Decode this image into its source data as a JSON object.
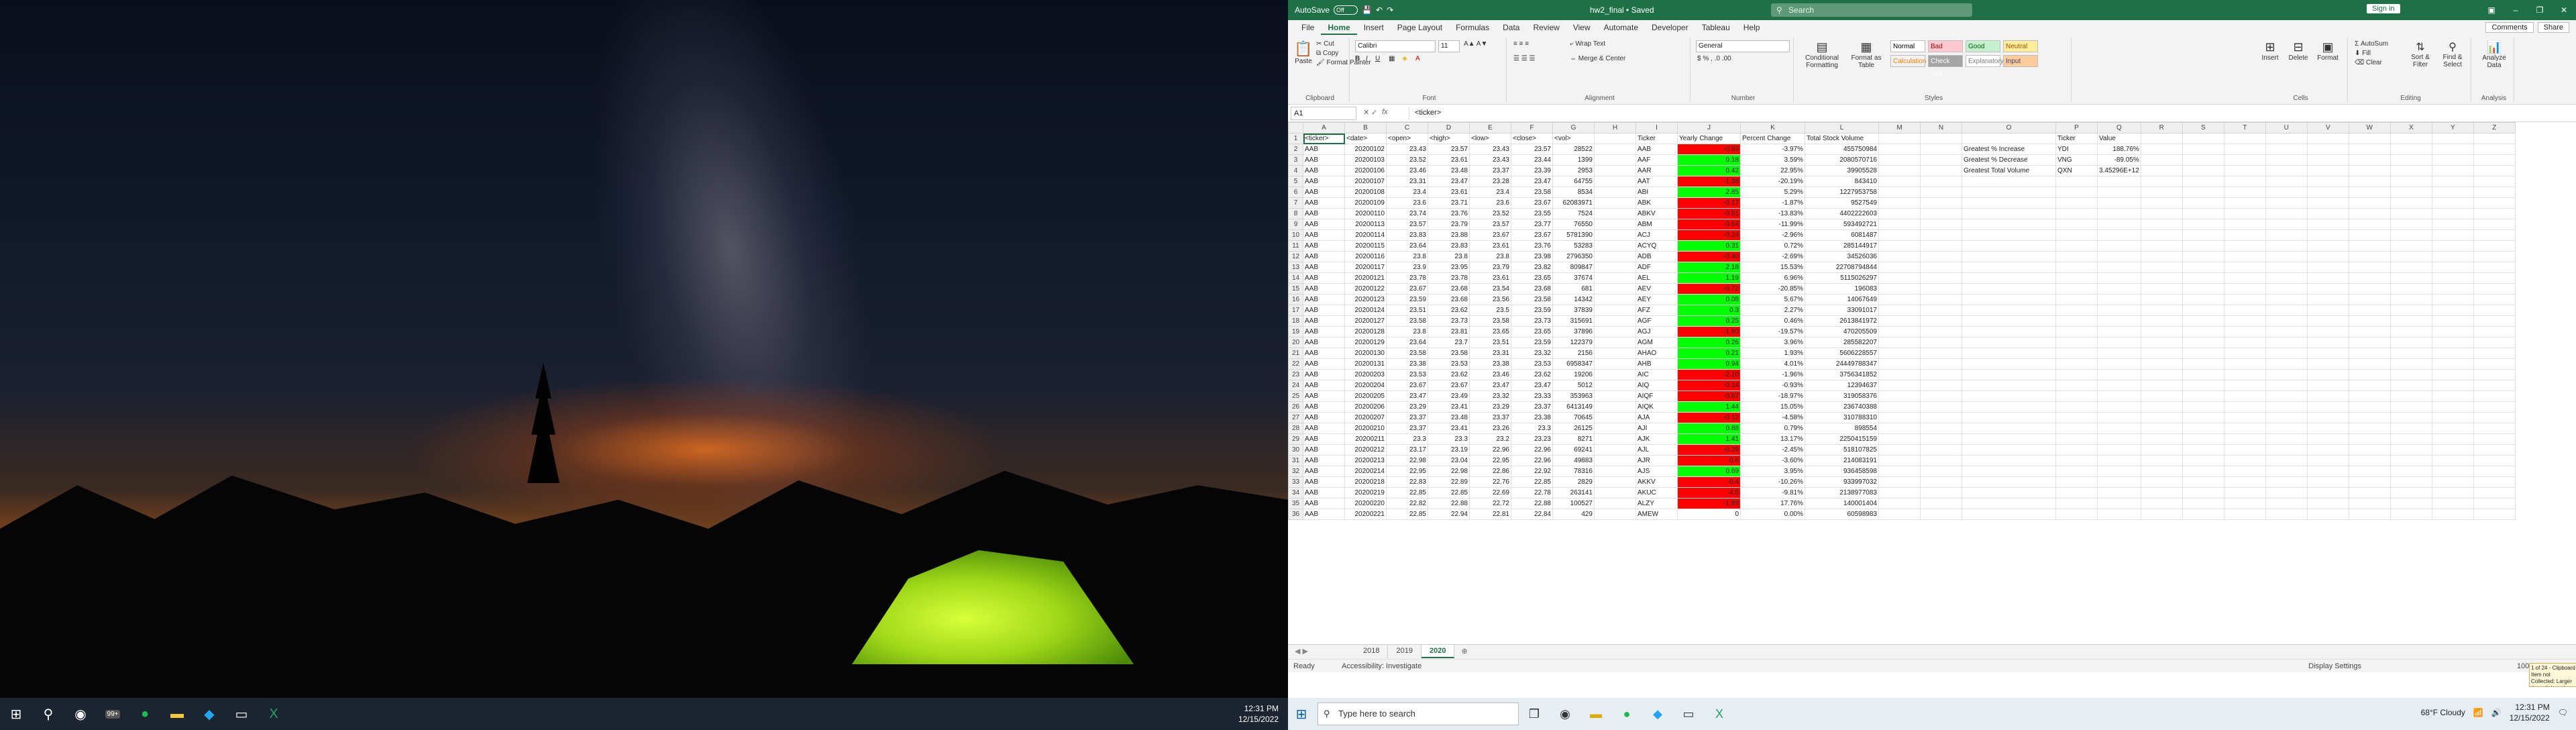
{
  "left_taskbar": {
    "icons": [
      "windows-icon",
      "search-icon",
      "chrome-icon",
      "weather-badge-icon",
      "spotify-icon",
      "explorer-icon",
      "vscode-icon",
      "terminal-icon",
      "excel-icon"
    ],
    "weather_badge": "99+",
    "time": "12:31 PM",
    "date": "12/15/2022"
  },
  "excel": {
    "title": {
      "autosave": "AutoSave",
      "toggle": "Off",
      "document": "hw2_final • Saved",
      "search": "Search",
      "signin": "Sign in"
    },
    "menu": {
      "items": [
        "File",
        "Home",
        "Insert",
        "Page Layout",
        "Formulas",
        "Data",
        "Review",
        "View",
        "Automate",
        "Developer",
        "Tableau",
        "Help"
      ],
      "active": "Home",
      "comments": "Comments",
      "share": "Share"
    },
    "ribbon": {
      "clipboard": {
        "paste": "Paste",
        "cut": "Cut",
        "copy": "Copy",
        "format_painter": "Format Painter",
        "label": "Clipboard"
      },
      "font": {
        "name": "Calibri",
        "size": "11",
        "label": "Font"
      },
      "alignment": {
        "wrap": "Wrap Text",
        "merge": "Merge & Center",
        "label": "Alignment"
      },
      "number": {
        "format": "General",
        "label": "Number"
      },
      "styles": {
        "conditional": "Conditional Formatting",
        "format_table": "Format as Table",
        "cells": [
          "Normal",
          "Bad",
          "Good",
          "Neutral",
          "Calculation",
          "Check Cell",
          "Explanatory...",
          "Input"
        ],
        "label": "Styles"
      },
      "cells": {
        "insert": "Insert",
        "delete": "Delete",
        "format": "Format",
        "label": "Cells"
      },
      "editing": {
        "autosum": "AutoSum",
        "fill": "Fill",
        "clear": "Clear",
        "sort": "Sort & Filter",
        "find": "Find & Select",
        "label": "Editing"
      },
      "analysis": {
        "analyze": "Analyze Data",
        "label": "Analysis"
      }
    },
    "formula_bar": {
      "name_box": "A1",
      "fx": "fx",
      "content": "<ticker>"
    },
    "columns": [
      "A",
      "B",
      "C",
      "D",
      "E",
      "F",
      "G",
      "H",
      "I",
      "J",
      "K",
      "L",
      "M",
      "N",
      "O",
      "P",
      "Q",
      "R",
      "S",
      "T",
      "U",
      "V",
      "W",
      "X",
      "Y",
      "Z"
    ],
    "headers": [
      "<ticker>",
      "<date>",
      "<open>",
      "<high>",
      "<low>",
      "<close>",
      "<vol>",
      "",
      "Ticker",
      "Yearly Change",
      "Percent Change",
      "Total Stock Volume"
    ],
    "rows": [
      [
        "AAB",
        "20200102",
        "23.43",
        "23.57",
        "23.43",
        "23.57",
        "28522",
        "",
        "AAB",
        "-0.93",
        "-3.97%",
        "455750984"
      ],
      [
        "AAB",
        "20200103",
        "23.52",
        "23.61",
        "23.43",
        "23.44",
        "1399",
        "",
        "AAF",
        "0.18",
        "3.59%",
        "2080570716"
      ],
      [
        "AAB",
        "20200106",
        "23.46",
        "23.48",
        "23.37",
        "23.39",
        "2953",
        "",
        "AAR",
        "0.42",
        "22.95%",
        "39905528"
      ],
      [
        "AAB",
        "20200107",
        "23.31",
        "23.47",
        "23.28",
        "23.47",
        "64755",
        "",
        "AAT",
        "-1.38",
        "-20.19%",
        "843410"
      ],
      [
        "AAB",
        "20200108",
        "23.4",
        "23.61",
        "23.4",
        "23.58",
        "8534",
        "",
        "ABI",
        "2.85",
        "5.29%",
        "1227953758"
      ],
      [
        "AAB",
        "20200109",
        "23.6",
        "23.71",
        "23.6",
        "23.67",
        "62083971",
        "",
        "ABK",
        "-0.17",
        "-1.87%",
        "9527549"
      ],
      [
        "AAB",
        "20200110",
        "23.74",
        "23.76",
        "23.52",
        "23.55",
        "7524",
        "",
        "ABKV",
        "-0.51",
        "-13.83%",
        "4402222603"
      ],
      [
        "AAB",
        "20200113",
        "23.57",
        "23.79",
        "23.57",
        "23.77",
        "76550",
        "",
        "ABM",
        "-0.64",
        "-11.99%",
        "593492721"
      ],
      [
        "AAB",
        "20200114",
        "23.83",
        "23.88",
        "23.67",
        "23.67",
        "5781390",
        "",
        "ACJ",
        "-0.24",
        "-2.96%",
        "6081487"
      ],
      [
        "AAB",
        "20200115",
        "23.64",
        "23.83",
        "23.61",
        "23.76",
        "53283",
        "",
        "ACYQ",
        "0.31",
        "0.72%",
        "285144917"
      ],
      [
        "AAB",
        "20200116",
        "23.8",
        "23.8",
        "23.8",
        "23.98",
        "2796350",
        "",
        "ADB",
        "-0.40",
        "-2.69%",
        "34526036"
      ],
      [
        "AAB",
        "20200117",
        "23.9",
        "23.95",
        "23.79",
        "23.82",
        "809847",
        "",
        "ADF",
        "2.18",
        "15.53%",
        "22708794844"
      ],
      [
        "AAB",
        "20200121",
        "23.78",
        "23.78",
        "23.61",
        "23.65",
        "37674",
        "",
        "AEL",
        "1.19",
        "6.96%",
        "5115026297"
      ],
      [
        "AAB",
        "20200122",
        "23.67",
        "23.68",
        "23.54",
        "23.68",
        "681",
        "",
        "AEV",
        "-0.72",
        "-20.85%",
        "196083"
      ],
      [
        "AAB",
        "20200123",
        "23.59",
        "23.68",
        "23.56",
        "23.58",
        "14342",
        "",
        "AEY",
        "0.08",
        "5.67%",
        "14067649"
      ],
      [
        "AAB",
        "20200124",
        "23.51",
        "23.62",
        "23.5",
        "23.59",
        "37839",
        "",
        "AFZ",
        "0.3",
        "2.27%",
        "33091017"
      ],
      [
        "AAB",
        "20200127",
        "23.58",
        "23.73",
        "23.58",
        "23.73",
        "315691",
        "",
        "AGF",
        "0.25",
        "0.46%",
        "2613841972"
      ],
      [
        "AAB",
        "20200128",
        "23.8",
        "23.81",
        "23.65",
        "23.65",
        "37896",
        "",
        "AGJ",
        "-1.60",
        "-19.57%",
        "470205509"
      ],
      [
        "AAB",
        "20200129",
        "23.64",
        "23.7",
        "23.51",
        "23.59",
        "122379",
        "",
        "AGM",
        "0.26",
        "3.96%",
        "285582207"
      ],
      [
        "AAB",
        "20200130",
        "23.58",
        "23.58",
        "23.31",
        "23.32",
        "2156",
        "",
        "AHAO",
        "0.21",
        "1.93%",
        "5606228557"
      ],
      [
        "AAB",
        "20200131",
        "23.38",
        "23.53",
        "23.38",
        "23.53",
        "6958347",
        "",
        "AHB",
        "0.94",
        "4.01%",
        "24449788347"
      ],
      [
        "AAB",
        "20200203",
        "23.53",
        "23.62",
        "23.46",
        "23.62",
        "19206",
        "",
        "AIC",
        "-2.10",
        "-1.96%",
        "3756341852"
      ],
      [
        "AAB",
        "20200204",
        "23.67",
        "23.67",
        "23.47",
        "23.47",
        "5012",
        "",
        "AIQ",
        "-0.14",
        "-0.93%",
        "12394637"
      ],
      [
        "AAB",
        "20200205",
        "23.47",
        "23.49",
        "23.32",
        "23.33",
        "353963",
        "",
        "AIQF",
        "-0.87",
        "-18.97%",
        "319058376"
      ],
      [
        "AAB",
        "20200206",
        "23.29",
        "23.41",
        "23.29",
        "23.37",
        "6413149",
        "",
        "AIQK",
        "1.44",
        "15.05%",
        "236740388"
      ],
      [
        "AAB",
        "20200207",
        "23.37",
        "23.48",
        "23.37",
        "23.38",
        "70645",
        "",
        "AJA",
        "-0.12",
        "-4.58%",
        "310788310"
      ],
      [
        "AAB",
        "20200210",
        "23.37",
        "23.41",
        "23.26",
        "23.3",
        "26125",
        "",
        "AJI",
        "0.88",
        "0.79%",
        "898554"
      ],
      [
        "AAB",
        "20200211",
        "23.3",
        "23.3",
        "23.2",
        "23.23",
        "8271",
        "",
        "AJK",
        "1.41",
        "13.17%",
        "2250415159"
      ],
      [
        "AAB",
        "20200212",
        "23.17",
        "23.19",
        "22.96",
        "22.96",
        "69241",
        "",
        "AJL",
        "-0.39",
        "-2.45%",
        "518107825"
      ],
      [
        "AAB",
        "20200213",
        "22.98",
        "23.04",
        "22.95",
        "22.96",
        "49883",
        "",
        "AJR",
        "-0.6",
        "-3.60%",
        "214083191"
      ],
      [
        "AAB",
        "20200214",
        "22.95",
        "22.98",
        "22.86",
        "22.92",
        "78316",
        "",
        "AJS",
        "0.69",
        "3.95%",
        "936458598"
      ],
      [
        "AAB",
        "20200218",
        "22.83",
        "22.89",
        "22.76",
        "22.85",
        "2829",
        "",
        "AKKV",
        "-0.4",
        "-10.26%",
        "933997032"
      ],
      [
        "AAB",
        "20200219",
        "22.85",
        "22.85",
        "22.69",
        "22.78",
        "263141",
        "",
        "AKUC",
        "-4.5",
        "-9.81%",
        "2138977083"
      ],
      [
        "AAB",
        "20200220",
        "22.82",
        "22.88",
        "22.72",
        "22.88",
        "100527",
        "",
        "ALZY",
        "-1.89",
        "17.76%",
        "140001404"
      ],
      [
        "AAB",
        "20200221",
        "22.85",
        "22.94",
        "22.81",
        "22.84",
        "429",
        "",
        "AMEW",
        "0",
        "0.00%",
        "60598983"
      ]
    ],
    "summary": {
      "headers": [
        "",
        "Ticker",
        "Value"
      ],
      "rows": [
        [
          "Greatest % Increase",
          "YDI",
          "188.76%"
        ],
        [
          "Greatest % Decrease",
          "VNG",
          "-89.05%"
        ],
        [
          "Greatest Total Volume",
          "QXN",
          "3.45296E+12"
        ]
      ]
    },
    "sheets": [
      "2018",
      "2019",
      "2020"
    ],
    "active_sheet": "2020",
    "status": {
      "ready": "Ready",
      "accessibility": "Accessibility: Investigate",
      "display": "Display Settings",
      "zoom": "100%"
    },
    "clipboard_note": "1 of 24 - Clipboard Item not Collected: Larger than clipboard capacity"
  },
  "right_taskbar": {
    "search_placeholder": "Type here to search",
    "weather": "68°F  Cloudy",
    "time": "12:31 PM",
    "date": "12/15/2022"
  }
}
